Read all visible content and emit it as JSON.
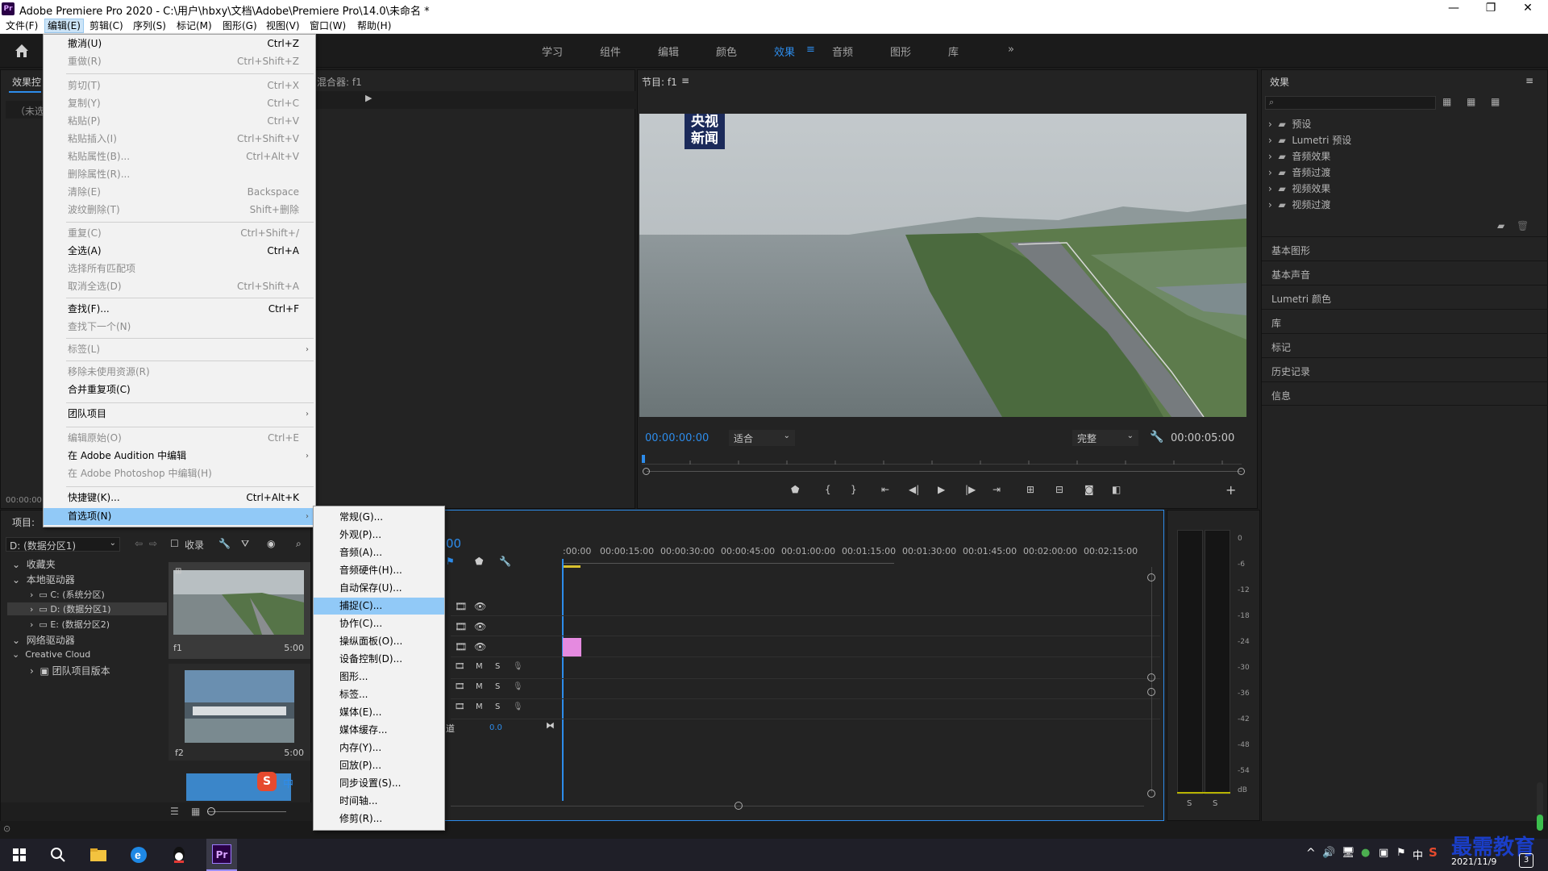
{
  "window": {
    "title": "Adobe Premiere Pro 2020 - C:\\用户\\hbxy\\文档\\Adobe\\Premiere Pro\\14.0\\未命名 *",
    "app_badge": "Pr",
    "minimize": "—",
    "restore": "❐",
    "close": "✕"
  },
  "menubar": [
    "文件(F)",
    "编辑(E)",
    "剪辑(C)",
    "序列(S)",
    "标记(M)",
    "图形(G)",
    "视图(V)",
    "窗口(W)",
    "帮助(H)"
  ],
  "workspaces": [
    "学习",
    "组件",
    "编辑",
    "颜色",
    "效果",
    "音频",
    "图形",
    "库"
  ],
  "workspace_active": "效果",
  "workspace_menu_glyph": "≡",
  "workspace_more": "»",
  "edit_menu": [
    {
      "label": "撤消(U)",
      "shortcut": "Ctrl+Z",
      "disabled": false
    },
    {
      "label": "重做(R)",
      "shortcut": "Ctrl+Shift+Z",
      "disabled": true
    },
    {
      "label": "剪切(T)",
      "shortcut": "Ctrl+X",
      "disabled": true
    },
    {
      "label": "复制(Y)",
      "shortcut": "Ctrl+C",
      "disabled": true
    },
    {
      "label": "粘贴(P)",
      "shortcut": "Ctrl+V",
      "disabled": true
    },
    {
      "label": "粘贴插入(I)",
      "shortcut": "Ctrl+Shift+V",
      "disabled": true
    },
    {
      "label": "粘贴属性(B)...",
      "shortcut": "Ctrl+Alt+V",
      "disabled": true
    },
    {
      "label": "删除属性(R)...",
      "shortcut": "",
      "disabled": true
    },
    {
      "label": "清除(E)",
      "shortcut": "Backspace",
      "disabled": true
    },
    {
      "label": "波纹删除(T)",
      "shortcut": "Shift+删除",
      "disabled": true
    },
    {
      "label": "重复(C)",
      "shortcut": "Ctrl+Shift+/",
      "disabled": true
    },
    {
      "label": "全选(A)",
      "shortcut": "Ctrl+A",
      "disabled": false
    },
    {
      "label": "选择所有匹配项",
      "shortcut": "",
      "disabled": true
    },
    {
      "label": "取消全选(D)",
      "shortcut": "Ctrl+Shift+A",
      "disabled": true
    },
    {
      "label": "查找(F)...",
      "shortcut": "Ctrl+F",
      "disabled": false
    },
    {
      "label": "查找下一个(N)",
      "shortcut": "",
      "disabled": true
    },
    {
      "label": "标签(L)",
      "shortcut": "",
      "disabled": true,
      "submenu": true
    },
    {
      "label": "移除未使用资源(R)",
      "shortcut": "",
      "disabled": true
    },
    {
      "label": "合并重复项(C)",
      "shortcut": "",
      "disabled": false
    },
    {
      "label": "团队项目",
      "shortcut": "",
      "disabled": false,
      "submenu": true
    },
    {
      "label": "编辑原始(O)",
      "shortcut": "Ctrl+E",
      "disabled": true
    },
    {
      "label": "在 Adobe Audition 中编辑",
      "shortcut": "",
      "disabled": false,
      "submenu": true
    },
    {
      "label": "在 Adobe Photoshop 中编辑(H)",
      "shortcut": "",
      "disabled": true
    },
    {
      "label": "快捷键(K)...",
      "shortcut": "Ctrl+Alt+K",
      "disabled": false
    },
    {
      "label": "首选项(N)",
      "shortcut": "",
      "disabled": false,
      "submenu": true,
      "highlighted": true
    }
  ],
  "prefs_menu": [
    {
      "label": "常规(G)...",
      "highlighted": false
    },
    {
      "label": "外观(P)...",
      "highlighted": false
    },
    {
      "label": "音频(A)...",
      "highlighted": false
    },
    {
      "label": "音频硬件(H)...",
      "highlighted": false
    },
    {
      "label": "自动保存(U)...",
      "highlighted": false
    },
    {
      "label": "捕捉(C)...",
      "highlighted": true
    },
    {
      "label": "协作(C)...",
      "highlighted": false
    },
    {
      "label": "操纵面板(O)...",
      "highlighted": false
    },
    {
      "label": "设备控制(D)...",
      "highlighted": false
    },
    {
      "label": "图形...",
      "highlighted": false
    },
    {
      "label": "标签...",
      "highlighted": false
    },
    {
      "label": "媒体(E)...",
      "highlighted": false
    },
    {
      "label": "媒体缓存...",
      "highlighted": false
    },
    {
      "label": "内存(Y)...",
      "highlighted": false
    },
    {
      "label": "回放(P)...",
      "highlighted": false
    },
    {
      "label": "同步设置(S)...",
      "highlighted": false
    },
    {
      "label": "时间轴...",
      "highlighted": false
    },
    {
      "label": "修剪(R)...",
      "highlighted": false
    }
  ],
  "source_panel": {
    "tab": "效果控",
    "mixer_tab": "混合器: f1",
    "unselected": "（未选",
    "timecode": "00:00:00"
  },
  "program": {
    "title": "节目: f1",
    "menu_glyph": "≡",
    "timecode_left": "00:00:00:00",
    "fit": "适合",
    "quality": "完整",
    "timecode_right": "00:00:05:00",
    "logo_line1": "央视",
    "logo_line2": "新闻"
  },
  "effects": {
    "title": "效果",
    "menu_glyph": "≡",
    "search_placeholder": "",
    "tree": [
      "预设",
      "Lumetri 预设",
      "音频效果",
      "音频过渡",
      "视频效果",
      "视频过渡"
    ],
    "sections": [
      "基本图形",
      "基本声音",
      "Lumetri 颜色",
      "库",
      "标记",
      "历史记录",
      "信息"
    ]
  },
  "project": {
    "tab": "项目: ",
    "drive": "D: (数据分区1)",
    "collect": "收录",
    "tree": [
      {
        "label": "收藏夹",
        "level": 0,
        "expanded": true
      },
      {
        "label": "本地驱动器",
        "level": 0,
        "expanded": true
      },
      {
        "label": "C: (系统分区)",
        "level": 1
      },
      {
        "label": "D: (数据分区1)",
        "level": 1,
        "selected": true
      },
      {
        "label": "E: (数据分区2)",
        "level": 1
      },
      {
        "label": "网络驱动器",
        "level": 0,
        "expanded": true
      },
      {
        "label": "Creative Cloud",
        "level": 0,
        "expanded": true
      },
      {
        "label": "团队项目版本",
        "level": 1
      }
    ],
    "clips": [
      {
        "name": "f1",
        "duration": "5:00"
      },
      {
        "name": "f2",
        "duration": "5:00"
      }
    ],
    "ime_label": "中"
  },
  "timeline": {
    "timecode_partial": "00",
    "ticks": [
      ":00:00",
      "00:00:15:00",
      "00:00:30:00",
      "00:00:45:00",
      "00:01:00:00",
      "00:01:15:00",
      "00:01:30:00",
      "00:01:45:00",
      "00:02:00:00",
      "00:02:15:00"
    ],
    "mute": "M",
    "solo": "S",
    "master_label": "道",
    "master_value": "0.0"
  },
  "meter": {
    "db_labels": [
      "0",
      "-6",
      "-12",
      "-18",
      "-24",
      "-30",
      "-36",
      "-42",
      "-48",
      "-54",
      "dB"
    ],
    "solo_left": "S",
    "solo_right": "S"
  },
  "taskbar": {
    "ime": "中",
    "clock_date": "2021/11/9",
    "watermark": "最需教育",
    "notif_count": "3"
  },
  "colors": {
    "accent": "#2d8ceb",
    "menu_highlight": "#91c9f7",
    "clip_pink": "#e58ae0"
  }
}
